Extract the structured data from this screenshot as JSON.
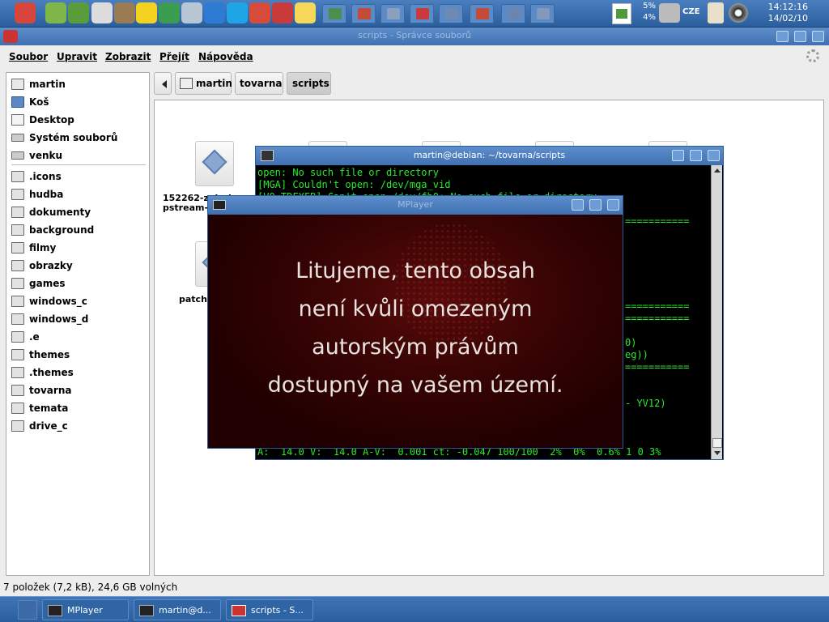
{
  "top_panel": {
    "launchers": [
      {
        "icon": "amiga-ball-icon",
        "color": "#d7463c"
      },
      {
        "icon": "android-phone-icon",
        "color": "#7fb64a"
      },
      {
        "icon": "android-robot-icon",
        "color": "#5a9b3a"
      },
      {
        "icon": "mail-icon",
        "color": "#dcdcdc"
      },
      {
        "icon": "gimp-icon",
        "color": "#9a7b52"
      },
      {
        "icon": "warning-icon",
        "color": "#f2d21f"
      },
      {
        "icon": "chrome-icon",
        "color": "#3b9d4f"
      },
      {
        "icon": "inkscape-icon",
        "color": "#b8c6d6"
      },
      {
        "icon": "dropbox-icon",
        "color": "#2d7bd3"
      },
      {
        "icon": "skype-icon",
        "color": "#1da5e8"
      },
      {
        "icon": "dc-icon",
        "color": "#d74b3a"
      },
      {
        "icon": "home-red-icon",
        "color": "#c93a3a"
      },
      {
        "icon": "moon-icon",
        "color": "#f5d85a"
      }
    ],
    "running": [
      {
        "icon": "chrome-task-icon",
        "color": "#4b8e4f"
      },
      {
        "icon": "dc-task-icon",
        "color": "#c44b3a"
      },
      {
        "icon": "folder-task-icon",
        "color": "#8aa0bf"
      },
      {
        "icon": "home-task-icon",
        "color": "#c93a3a"
      },
      {
        "icon": "screen-task-icon",
        "color": "#7089b0"
      },
      {
        "icon": "dc2-task-icon",
        "color": "#c44b3a"
      },
      {
        "icon": "monitor-task-icon",
        "color": "#6a86b0"
      },
      {
        "icon": "network-task-icon",
        "color": "#8298bd"
      }
    ],
    "cpu": [
      "5%",
      "4%"
    ],
    "lang": "CZE",
    "time": "14:12:16",
    "date": "14/02/10"
  },
  "file_manager": {
    "title": "scripts - Správce souborů",
    "menu": [
      "Soubor",
      "Upravit",
      "Zobrazit",
      "Přejít",
      "Nápověda"
    ],
    "sidebar": {
      "places": [
        {
          "label": "martin",
          "icon": "home"
        },
        {
          "label": "Koš",
          "icon": "trash"
        },
        {
          "label": "Desktop",
          "icon": "desk"
        },
        {
          "label": "Systém souborů",
          "icon": "drive"
        },
        {
          "label": "venku",
          "icon": "drive"
        }
      ],
      "bookmarks": [
        ".icons",
        "hudba",
        "dokumenty",
        "background",
        "filmy",
        "obrazky",
        "games",
        "windows_c",
        "windows_d",
        ".e",
        "themes",
        ".themes",
        "tovarna",
        "temata",
        "drive_c"
      ]
    },
    "path": [
      "martin",
      "tovarna",
      "scripts"
    ],
    "files": [
      {
        "label": "152262-zoh-dumpstream-3038.sh"
      },
      {
        "label": ""
      },
      {
        "label": ""
      },
      {
        "label": ""
      },
      {
        "label": ""
      },
      {
        "label": "patch"
      }
    ],
    "status": "7 položek (7,2 kB), 24,6 GB volných"
  },
  "terminal": {
    "title": "martin@debian: ~/tovarna/scripts",
    "lines": [
      "open: No such file or directory",
      "[MGA] Couldn't open: /dev/mga_vid",
      "[VO_TDFXFB] Can't open /dev/fb0: No such file or directory.",
      "",
      "",
      "",
      "",
      "",
      "",
      "",
      "",
      "",
      "",
      "",
      "",
      "",
      "",
      "",
      "",
      "",
      "",
      "",
      ""
    ],
    "right_fragments": [
      {
        "line": 4,
        "text": "==========="
      },
      {
        "line": 11,
        "text": "==========="
      },
      {
        "line": 12,
        "text": "==========="
      },
      {
        "line": 14,
        "text": "0)"
      },
      {
        "line": 15,
        "text": "eg))"
      },
      {
        "line": 16,
        "text": "==========="
      },
      {
        "line": 19,
        "text": "- YV12)"
      }
    ],
    "status_line": "A:  14.0 V:  14.0 A-V:  0.001 ct: -0.047 100/100  2%  0%  0.6% 1 0 3%"
  },
  "mplayer": {
    "title": "MPlayer",
    "message": [
      "Litujeme, tento obsah",
      "není kvůli omezeným",
      "autorským právům",
      "dostupný na vašem území."
    ]
  },
  "taskbar": {
    "tasks": [
      {
        "label": "MPlayer",
        "icon": "mplayer"
      },
      {
        "label": "martin@d...",
        "icon": "terminal"
      },
      {
        "label": "scripts - S...",
        "icon": "filemanager"
      }
    ]
  },
  "colors": {
    "desktop": "#2f6aa8",
    "titlebar": "#4f80c0",
    "terminal_text": "#2ce82c",
    "video_bg": "#3a0404"
  }
}
